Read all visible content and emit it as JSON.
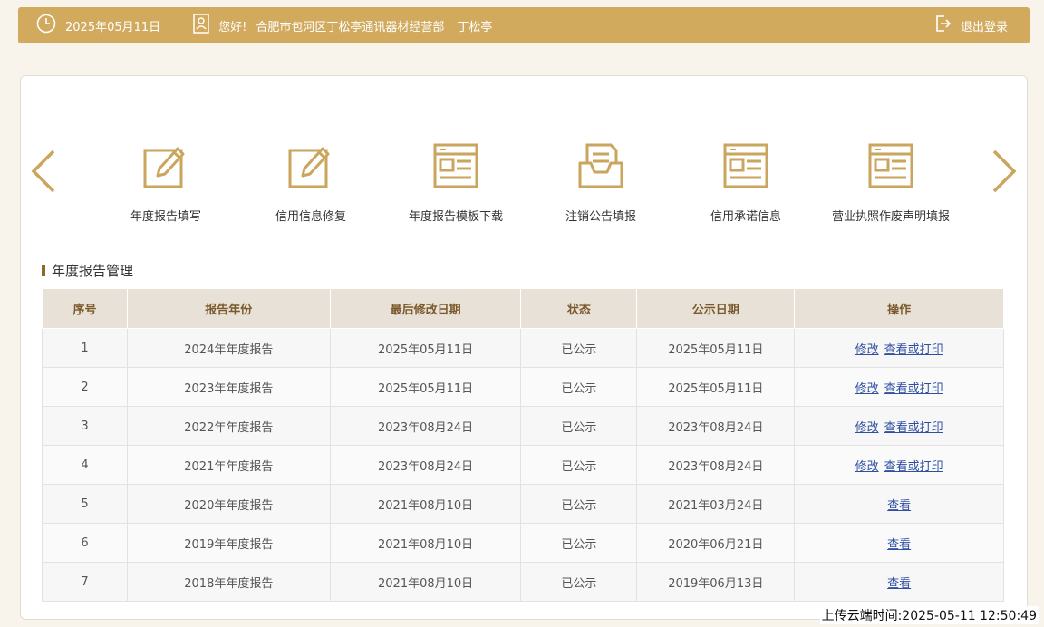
{
  "header": {
    "date": "2025年05月11日",
    "greeting": "您好!",
    "company": "合肥市包河区丁松亭通讯器材经营部",
    "user": "丁松亭",
    "logout_label": "退出登录",
    "color": "#d2aa5e"
  },
  "services": [
    {
      "label": "年度报告填写",
      "icon": "pencil-edit-icon"
    },
    {
      "label": "信用信息修复",
      "icon": "pencil-edit-icon"
    },
    {
      "label": "年度报告模板下载",
      "icon": "document-template-icon"
    },
    {
      "label": "注销公告填报",
      "icon": "inbox-tray-icon"
    },
    {
      "label": "信用承诺信息",
      "icon": "document-template-icon"
    },
    {
      "label": "营业执照作废声明填报",
      "icon": "document-template-icon"
    }
  ],
  "section": {
    "title": "年度报告管理"
  },
  "table": {
    "headers": [
      "序号",
      "报告年份",
      "最后修改日期",
      "状态",
      "公示日期",
      "操作"
    ],
    "rows": [
      {
        "no": "1",
        "year": "2024年年度报告",
        "modified": "2025年05月11日",
        "status": "已公示",
        "published": "2025年05月11日",
        "ops": [
          "修改",
          "查看或打印"
        ]
      },
      {
        "no": "2",
        "year": "2023年年度报告",
        "modified": "2025年05月11日",
        "status": "已公示",
        "published": "2025年05月11日",
        "ops": [
          "修改",
          "查看或打印"
        ]
      },
      {
        "no": "3",
        "year": "2022年年度报告",
        "modified": "2023年08月24日",
        "status": "已公示",
        "published": "2023年08月24日",
        "ops": [
          "修改",
          "查看或打印"
        ]
      },
      {
        "no": "4",
        "year": "2021年年度报告",
        "modified": "2023年08月24日",
        "status": "已公示",
        "published": "2023年08月24日",
        "ops": [
          "修改",
          "查看或打印"
        ]
      },
      {
        "no": "5",
        "year": "2020年年度报告",
        "modified": "2021年08月10日",
        "status": "已公示",
        "published": "2021年03月24日",
        "ops": [
          "查看"
        ]
      },
      {
        "no": "6",
        "year": "2019年年度报告",
        "modified": "2021年08月10日",
        "status": "已公示",
        "published": "2020年06月21日",
        "ops": [
          "查看"
        ]
      },
      {
        "no": "7",
        "year": "2018年年度报告",
        "modified": "2021年08月10日",
        "status": "已公示",
        "published": "2019年06月13日",
        "ops": [
          "查看"
        ]
      }
    ]
  },
  "footer": {
    "upload_time": "上传云端时间:2025-05-11 12:50:49"
  }
}
